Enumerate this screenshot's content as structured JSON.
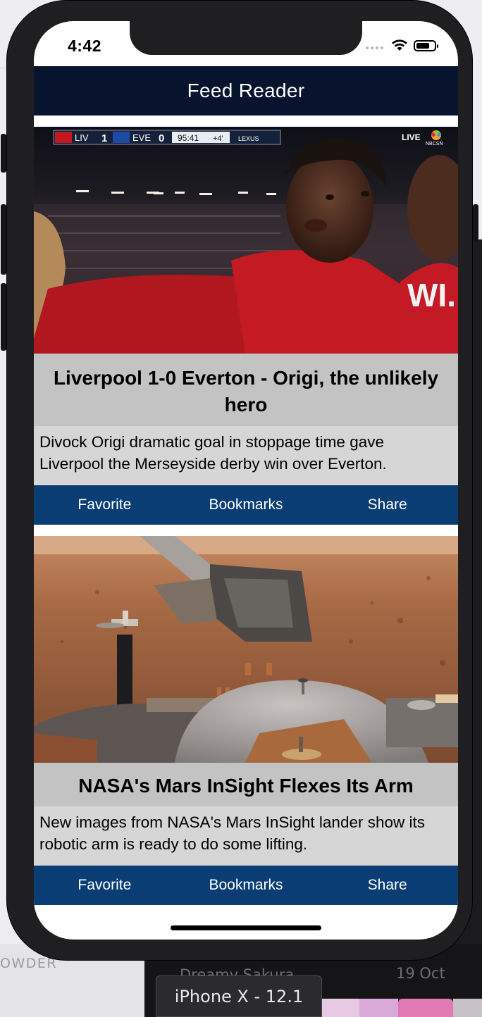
{
  "status_bar": {
    "time": "4:42"
  },
  "nav": {
    "title": "Feed Reader"
  },
  "feed": [
    {
      "image_icon": "football-match-photo",
      "scoreboard": {
        "home": "LIV",
        "home_score": "1",
        "away": "EVE",
        "away_score": "0",
        "clock": "95:41",
        "added": "+4'",
        "sponsor": "LEXUS",
        "live": "LIVE",
        "network": "NBCSN"
      },
      "title": "Liverpool 1-0 Everton - Origi, the unlikely hero",
      "description": "Divock Origi dramatic goal in stoppage time gave Liverpool the Merseyside derby win over Everton.",
      "actions": {
        "favorite": "Favorite",
        "bookmarks": "Bookmarks",
        "share": "Share"
      }
    },
    {
      "image_icon": "mars-lander-photo",
      "title": "NASA's Mars InSight Flexes Its Arm",
      "description": "New images from NASA's Mars InSight lander show its robotic arm is ready to do some lifting.",
      "actions": {
        "favorite": "Favorite",
        "bookmarks": "Bookmarks",
        "share": "Share"
      }
    }
  ],
  "simulator": {
    "device_label": "iPhone X - 12.1"
  },
  "background": {
    "left_text": "OWDER",
    "list_item": "Dreamy Sakura",
    "list_date": "19 Oct"
  },
  "colors": {
    "nav_bar": "#08132e",
    "action_bar": "#0a3d74",
    "title_bg": "#c3c3c3",
    "desc_bg": "#d6d6d6"
  }
}
